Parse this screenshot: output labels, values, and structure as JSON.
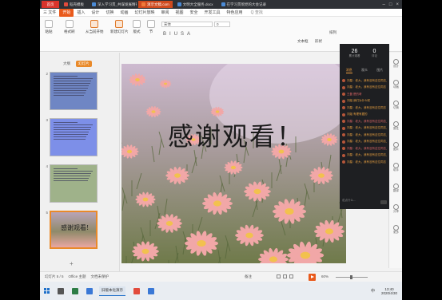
{
  "tabs": [
    {
      "label": "首页",
      "color": "#d9342b",
      "active": false,
      "home": true
    },
    {
      "label": "稻壳模板",
      "color": "#e24b3c",
      "active": false
    },
    {
      "label": "深入学习贯_共谋发展精神",
      "color": "#4b8bd6",
      "active": false
    },
    {
      "label": "演示文稿.com",
      "color": "#f07a3a",
      "active": true
    },
    {
      "label": "文明大全服务.docx",
      "color": "#4b8bd6",
      "active": false
    },
    {
      "label": "在学习贯彻党的大会记录表",
      "color": "#4b8bd6",
      "active": false
    }
  ],
  "menu": [
    "三 文件",
    "开始",
    "插入",
    "设计",
    "切换",
    "动画",
    "幻灯片放映",
    "审阅",
    "视图",
    "安全",
    "开发工具",
    "特色应用"
  ],
  "menu_active_index": 1,
  "menu_search": "Q 查找",
  "toolbar": {
    "paste": "粘贴",
    "format": "格式刷",
    "from_current": "从当前开始",
    "new_slide": "新建幻灯片",
    "layout": "版式",
    "section": "节",
    "font_name": "宋体",
    "font_size": "0",
    "textbox": "文本框",
    "shapes": "形状",
    "arrange": "排列",
    "glyphs": [
      "B",
      "I",
      "U",
      "S",
      "A"
    ]
  },
  "left_panel": {
    "tabs": [
      "大纲",
      "幻灯片"
    ],
    "active_tab": 1,
    "slides": [
      {
        "num": "2",
        "bg": "#6f86c4",
        "lines": 9,
        "selected": false
      },
      {
        "num": "3",
        "bg": "#7d8fe8",
        "lines": 8,
        "selected": false
      },
      {
        "num": "4",
        "bg": "#9fb28a",
        "lines": 6,
        "selected": false
      },
      {
        "num": "5",
        "bg": "#c79a8a",
        "lines": 0,
        "selected": true,
        "caption": "感谢观看!"
      }
    ],
    "add_label": "+"
  },
  "slide": {
    "title": "感谢观看！",
    "sky_color": "#cdbad0",
    "grass_color": "#6f7a4a",
    "petal_color": "#f1a7a7",
    "center_color": "#f2c14e"
  },
  "live_panel": {
    "stats": [
      {
        "value": "26",
        "label": "累计观看"
      },
      {
        "value": "0",
        "label": "评论"
      }
    ],
    "tabs": [
      "消息",
      "观众",
      "图片"
    ],
    "active_tab": 0,
    "messages": [
      "刘星：老大，我有没有这位同志_刘",
      "刘星：老大，我有没有这位同志",
      "王磊 是的呀",
      "刘姐 我们为什么呢",
      "刘星：老大，我有没有这位同志",
      "刘姐 有理有据的",
      "刘星：老大，我有没有这位同志_刘",
      "刘星：老大，我有没有这位同志_刘",
      "刘星：老大，我有没有这位同志_刘",
      "刘星：老大，我有没有这位同志_刘",
      "刘星：老大，我有没有这位同志_刘",
      "刘星：老大，我有没有这位同志_刘",
      "刘星：老大，我有没有这位同志"
    ],
    "footer": "说点什么..."
  },
  "right_strip": [
    "设计",
    "动画",
    "切换",
    "属性",
    "图片",
    "助手",
    "翻译",
    "分享",
    "更多"
  ],
  "status": {
    "slide_index": "幻灯片 5 / 5",
    "theme": "Office 主题",
    "protection": "文档未保护",
    "notes": "备注",
    "zoom": "60%",
    "zoom_fraction": 0.45
  },
  "taskbar": {
    "app_label": "旧版本化演示",
    "lang": "中",
    "time": "13:40",
    "date": "2020/4/30"
  }
}
